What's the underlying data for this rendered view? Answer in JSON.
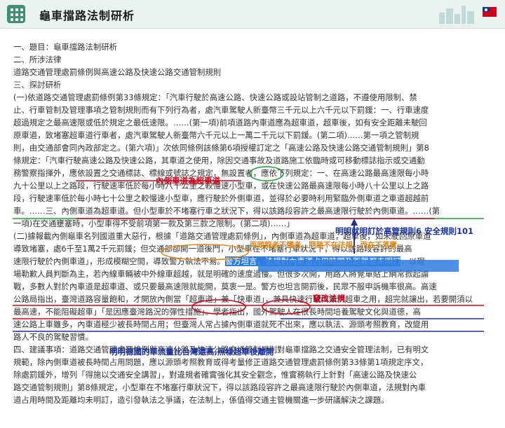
{
  "header": {
    "title": "龜車擋路法制研析",
    "menu_icon": "grid-menu-icon",
    "flag_icon": "roc-flag-icon"
  },
  "document": {
    "lines": [
      "一、題目：龜車擋路法制研析",
      "二、所涉法律",
      "道路交通管理處罰條例與高速公路及快速公路交通管制規則",
      "三、探討研析",
      "(一)依道路交通管理處罰條例第33條規定：「汽車行駛於高速公路、快速公路或設站管制之道路，不遵使用限制、禁",
      "止、行車管制及管理事項之管制規則而有下列行為者，處汽車駕駛人新臺幣三千元以上六千元以下罰鍰：一、行車速度",
      "超過規定之最高速限或低於規定之最低速限。……(第一項)前項道路內車道應為超車道，超車後，如有安全距離未駛回",
      "原車道，致堵塞超車道行車者，處汽車駕駛人新臺幣六千元以上一萬二千元以下罰鍰。(第二項)……第一項之管制規",
      "則，由交通部會同內政部定之。(第六項)」次依同條例該條第6項授權訂定之「高速公路及快速公路交通管制規則」第8",
      "條規定：「汽車行駛高速公路及快速公路，其車道之使用，除因交通事故及道路施工依臨時或可移動標誌指示或交通勤",
      "務警察指揮外，應依設置之交通標誌、標線或號誌之規定，無設置者，應依下列規定：一、在高速公路最高速限每小時",
      "九十公里以上之路段，行駛速率低於每小時八十公里之較慢速小型車，或在快速公路最高速限每小時八十公里以上之路",
      "段，行駛速率低於每小時七十公里之較慢速小型車，應行駛於外側車道，並得於必要時利用緊臨外側車道之車道超越前",
      "車。……三、內側車道為超車道。但小型車於不堵塞行車之狀況下，得以該路段容許之最高速限行駛於內側車道。……(第",
      "一項)在交通壅塞時，小型車得不受前項第一款及第三款之限制。(第二項)……」",
      "(二)據報載內側龜車名列國道重大惡行，根據「道路交通管理處罰條例」，內側車道為超車道，超車後，如未駛回原車道",
      "導致堵塞，處6千至1萬2千元罰鍰；但交通部卻開一道後門，小型車在不堵塞行車狀況下，得以該路段容許的最高",
      "速限行駛於內側車道」，形成模糊空間，導致警方執法不易。警方坦言，法規對內車道占用時間及距離都未明訂，以現",
      "場勒歉人員判斷為主，若內線車輛被中外線車超越，就是明確的速度過慢。但很多次開，用路人將覺單貼上網常掀起論",
      "戰，多數人對於內車道是超車道、或只要最高速限就能開，莫衷一是。警方也坦言開罰後，民眾不服申訴機率很高。高速",
      "公路局指出，臺灣道路容量飽和，才開放內側當「超車道」兼「快車道」，兼具快速行駛與兼供超車之用，超完就讓出，若要開須以",
      "最高速，不能阻礙超車」「是因應臺灣路況的彈性措施」。學者指出，國外駕駛人在很長時間培養駕駛文化與道德，高",
      "速公路上車雖多，內車道極少被長時間占用；但臺灣人常占據內側車道就死不出來，應以執法、源頭考照教育，改變用",
      "路人不良的駕駛習慣。",
      "四、建議事項：道路交通管理處罰條例與高速公路及快速公路交通管制規則對龜車擋路之交通安全管理法制，已有明文",
      "規範，除內側車道被長時間占用問題，應以源頭考照教育或得考量修正道路交通管理處罰條例第33條第1項規定序文，",
      "除處罰鍰外，增列「得施以交通安全講習」，對違規者確實強化其安全觀念，惟實務執行上針對「高速公路及快速公",
      "路交通管制規則」第8條規定，小型車在不堵塞行車狀況下，得以該路段容許之最高速限行駛於內側車道，法規對內車",
      "道占用時間及距離均未明訂，造引發執法之爭議，在法制上，係值得交通主管機關進一步研議解決之課題。"
    ],
    "highlight": "警方坦言，法規對內車道占用時間及距離都未明訂"
  },
  "annotations": {
    "inner_lane": "內側車道為超車道",
    "clearly_specified": "明明就明訂於高管規則6 安全規則101",
    "unclear_note": "兩頭龍者不懂者，問題不在法規，而在不落實",
    "false_regulation": "竄改法規",
    "germany_note": "明明德國的車流量比台灣還高,照樣超車後離開"
  },
  "colors": {
    "red": "#d0021b",
    "blue": "#1a2fa0",
    "orange": "#e08a1e",
    "green": "#1e9e3e",
    "highlight": "#2f7de1"
  }
}
